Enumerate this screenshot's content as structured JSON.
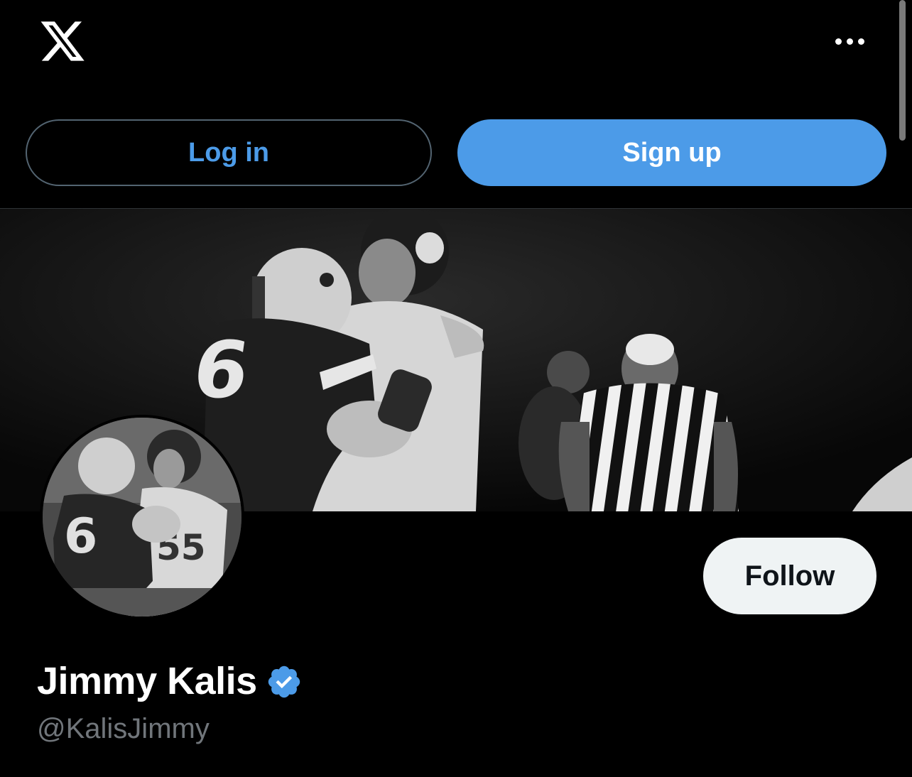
{
  "header": {
    "logo_icon": "x-logo-icon",
    "more_icon": "more-horizontal-icon"
  },
  "auth": {
    "login_label": "Log in",
    "signup_label": "Sign up"
  },
  "profile": {
    "display_name": "Jimmy Kalis",
    "handle": "@KalisJimmy",
    "verified": true,
    "follow_label": "Follow"
  },
  "colors": {
    "accent": "#4c9be8",
    "background": "#000000",
    "secondary_text": "#71767b",
    "follow_bg": "#eff3f4"
  }
}
